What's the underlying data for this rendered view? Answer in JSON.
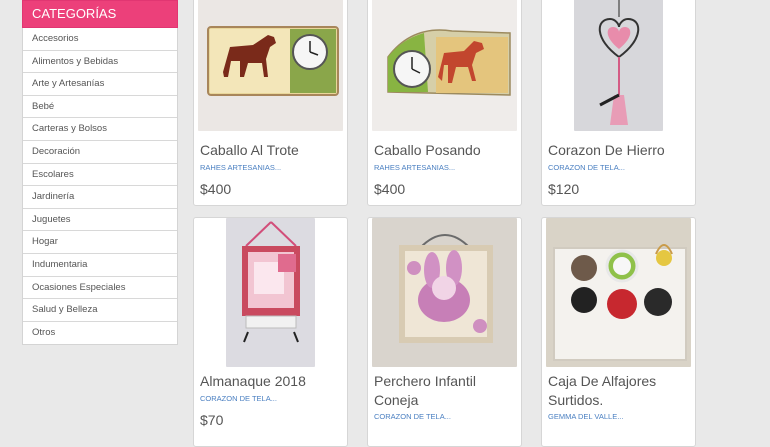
{
  "categories": {
    "header": "CATEGORÍAS",
    "items": [
      "Accesorios",
      "Alimentos y Bebidas",
      "Arte y Artesanías",
      "Bebé",
      "Carteras y Bolsos",
      "Decoración",
      "Escolares",
      "Jardinería",
      "Juguetes",
      "Hogar",
      "Indumentaria",
      "Ocasiones Especiales",
      "Salud y Belleza",
      "Otros"
    ]
  },
  "products": [
    {
      "title": "Caballo Al Trote",
      "seller": "RAHES ARTESANIAS...",
      "price": "$400"
    },
    {
      "title": "Caballo Posando",
      "seller": "RAHES ARTESANIAS...",
      "price": "$400"
    },
    {
      "title": "Corazon De Hierro",
      "seller": "CORAZON DE TELA...",
      "price": "$120"
    },
    {
      "title": "Almanaque 2018",
      "seller": "CORAZON DE TELA...",
      "price": "$70"
    },
    {
      "title": "Perchero Infantil Coneja",
      "seller": "CORAZON DE TELA...",
      "price": ""
    },
    {
      "title": "Caja De Alfajores Surtidos.",
      "seller": "GEMMA DEL VALLE...",
      "price": ""
    }
  ],
  "colors": {
    "accent": "#ec407a",
    "seller_link": "#4a7fc1"
  }
}
